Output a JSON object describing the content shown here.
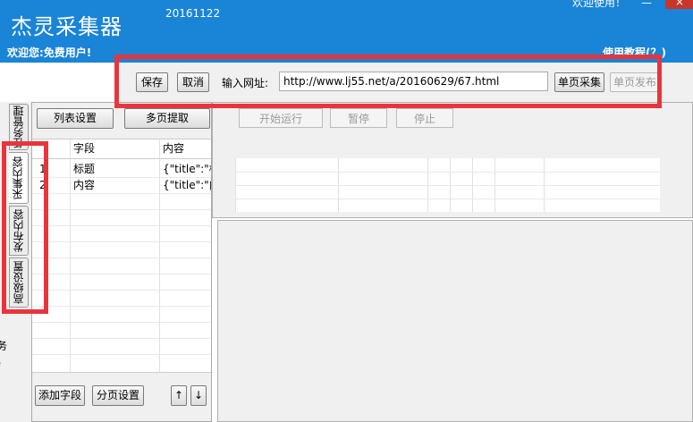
{
  "app": {
    "title": "杰灵采集器",
    "version": "20161122",
    "welcome_top": "欢迎使用！",
    "welcome": "欢迎您:免费用户!",
    "tutorial": "使用教程(？)",
    "minimize_glyph": "—",
    "close_glyph": "×"
  },
  "toolbar": {
    "save_label": "保存",
    "cancel_label": "取消",
    "url_label": "输入网址:",
    "url_value": "http://www.lj55.net/a/20160629/67.html",
    "single_collect_label": "单页采集",
    "single_publish_label": "单页发布"
  },
  "side_tabs": [
    "任务管理",
    "采集内容",
    "发布内容",
    "高级设置"
  ],
  "left_strip_text": [
    ":",
    "务",
    "f"
  ],
  "list_panel": {
    "list_settings_label": "列表设置",
    "multi_page_label": "多页提取",
    "columns": [
      "字段",
      "内容"
    ],
    "rows": [
      {
        "index": "1",
        "field": "标题",
        "content": "{\"title\":\"标题"
      },
      {
        "index": "2",
        "field": "内容",
        "content": "{\"title\":\"内容"
      }
    ],
    "add_field_label": "添加字段",
    "paging_label": "分页设置",
    "up_label": "↑",
    "down_label": "↓"
  },
  "run_panel": {
    "start_label": "开始运行",
    "pause_label": "暂停",
    "stop_label": "停止"
  },
  "colors": {
    "title_bar": "#1a84d6",
    "highlight_box": "#e8353b"
  }
}
